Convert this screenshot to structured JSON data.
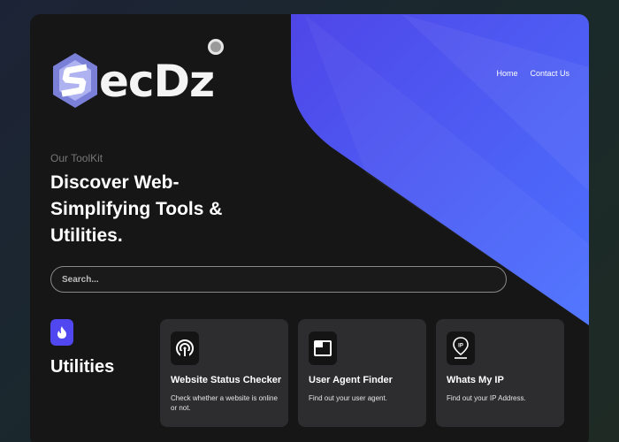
{
  "brand": {
    "logo_text": "ecDz",
    "logo_letter": "S"
  },
  "nav": {
    "items": [
      "Home",
      "Contact Us"
    ]
  },
  "hero": {
    "eyebrow": "Our ToolKit",
    "headline": "Discover Web-Simplifying Tools & Utilities."
  },
  "search": {
    "placeholder": "Search..."
  },
  "section": {
    "title": "Utilities",
    "icon": "fire-icon"
  },
  "cards": [
    {
      "title": "Website Status Checker",
      "desc": "Check whether a website is online or not.",
      "icon": "signal-icon"
    },
    {
      "title": "User Agent Finder",
      "desc": "Find out your user agent.",
      "icon": "browser-window-icon"
    },
    {
      "title": "Whats My IP",
      "desc": "Find out your IP Address.",
      "icon": "ip-location-icon"
    }
  ],
  "colors": {
    "accent": "#5147f0",
    "background": "#161616",
    "card": "#2d2d2f"
  }
}
